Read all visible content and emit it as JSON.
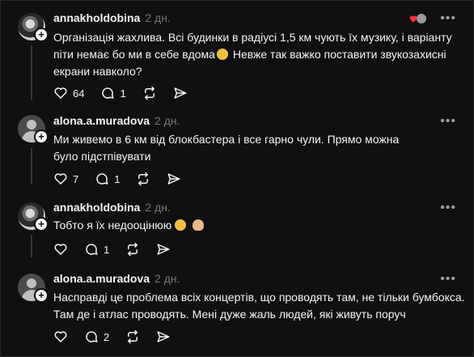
{
  "posts": [
    {
      "username": "annakholdobina",
      "time": "2 дн.",
      "text_line1": "Організація жахлива. Всі будинки в радіусі 1,5 км чують їх музику, і варіанту",
      "text_line2": "піти немає бо ми в себе вдома",
      "text_line2_tail": " Невже так важко поставити звукозахисні",
      "text_line3": "екрани навколо?",
      "likes": "64",
      "replies": "1",
      "avatar": "photo"
    },
    {
      "username": "alona.a.muradova",
      "time": "2 дн.",
      "text_line1": "Ми живемо в 6 км від блокбастера і все гарно чули. Прямо можна",
      "text_line2": "було підстпівувати",
      "likes": "7",
      "replies": "1",
      "avatar": "default"
    },
    {
      "username": "annakholdobina",
      "time": "2 дн.",
      "text_line1": "Тобто я їх недооцінюю",
      "likes": "",
      "replies": "1",
      "avatar": "photo"
    },
    {
      "username": "alona.a.muradova",
      "time": "2 дн.",
      "text_line1": "Насправді це проблема всіх концертів, що проводять там, не тільки бумбокса.",
      "text_line2": "Там де і атлас проводять. Мені дуже жаль людей, які живуть поруч",
      "likes": "",
      "replies": "2",
      "avatar": "default"
    }
  ],
  "icons": {
    "like": "heart-icon",
    "reply": "comment-icon",
    "repost": "repost-icon",
    "share": "share-icon",
    "more": "more-options-icon",
    "follow": "plus-icon"
  },
  "more_label": "•••"
}
